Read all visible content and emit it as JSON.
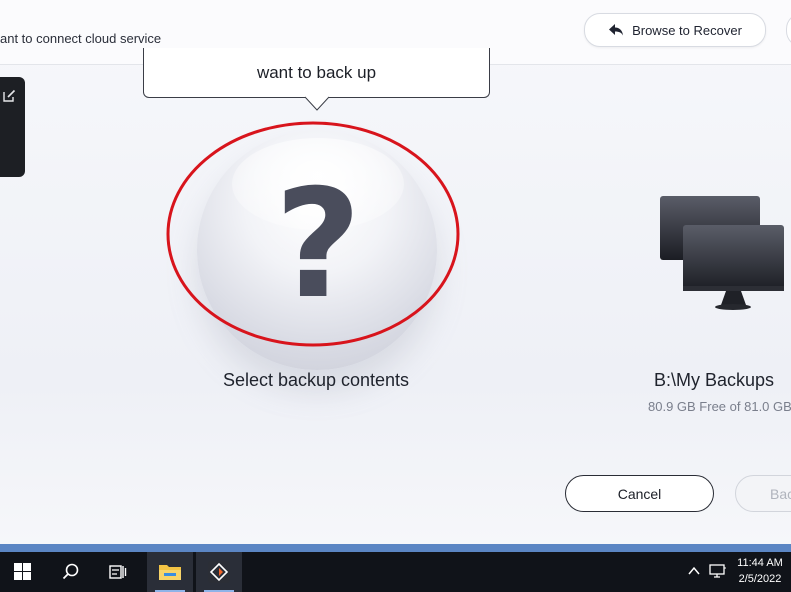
{
  "header": {
    "cloud_text": "ant to connect cloud service",
    "browse_label": "Browse to Recover"
  },
  "tooltip": {
    "text": "want to back up"
  },
  "source": {
    "label": "Select backup contents",
    "icon": "question-mark-icon"
  },
  "destination": {
    "label": "B:\\My Backups",
    "free": "80.9 GB Free of 81.0 GB",
    "icon": "monitor-icon"
  },
  "footer": {
    "cancel_label": "Cancel",
    "backup_label": "Backup"
  },
  "taskbar": {
    "time": "11:44 AM",
    "date": "2/5/2022",
    "items": [
      "start-icon",
      "search-icon",
      "task-view-icon",
      "file-explorer-icon",
      "backup-app-icon"
    ]
  },
  "colors": {
    "highlight_ellipse": "#d8141c",
    "taskbar": "#101319",
    "taskbar_strip": "#5b86c4"
  }
}
